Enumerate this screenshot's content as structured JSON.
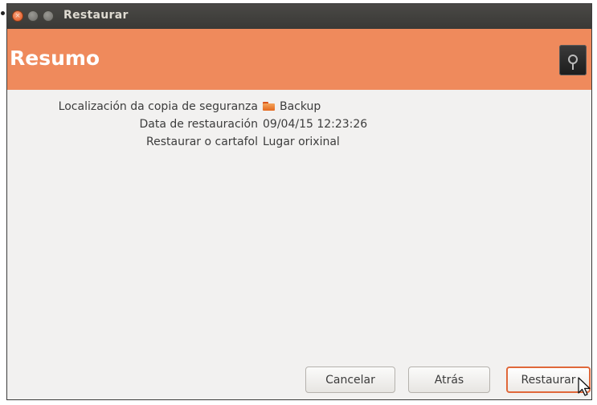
{
  "window": {
    "title": "Restaurar",
    "controls": {
      "close_icon": "close-icon",
      "minimize_icon": "minimize-icon",
      "maximize_icon": "maximize-icon"
    }
  },
  "header": {
    "title": "Resumo",
    "icon": "safe-icon",
    "color": "#ef8a5c"
  },
  "summary": {
    "rows": [
      {
        "label": "Localización da copia de seguranza",
        "value": "Backup",
        "icon": "folder-icon"
      },
      {
        "label": "Data de restauración",
        "value": "09/04/15 12:23:26"
      },
      {
        "label": "Restaurar o cartafol",
        "value": "Lugar orixinal"
      }
    ]
  },
  "buttons": {
    "cancel": "Cancelar",
    "back": "Atrás",
    "restore": "Restaurar"
  },
  "accent": "#e0683a"
}
